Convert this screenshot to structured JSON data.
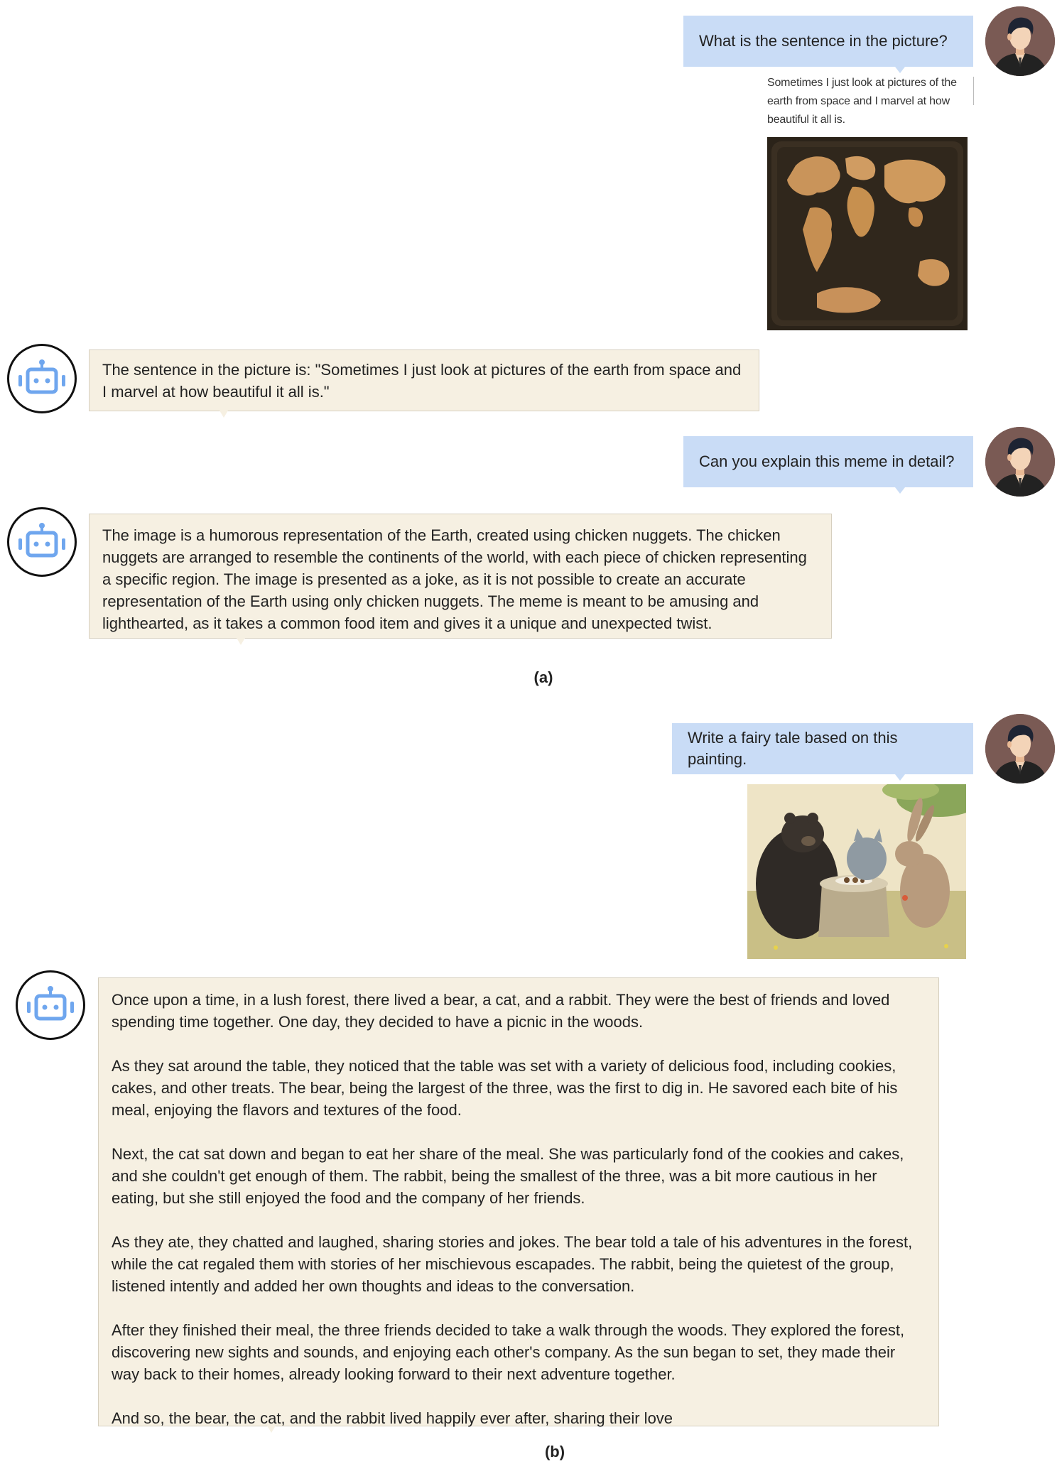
{
  "conversation_a": {
    "user_msg_1": "What is the sentence in the picture?",
    "meme_caption": "Sometimes I just look at pictures of the earth from space and I marvel at how beautiful it all is.",
    "bot_msg_1": "The sentence in the picture is: \"Sometimes I just look at pictures of the earth from space and I marvel at how beautiful it all is.\"",
    "user_msg_2": "Can you explain this meme in detail?",
    "bot_msg_2": "The image is a humorous representation of the Earth, created using chicken nuggets. The chicken nuggets are arranged to resemble the continents of the world, with each piece of chicken representing a specific region. The image is presented as a joke, as it is not possible to create an accurate representation of the Earth using only chicken nuggets. The meme is meant to be amusing and lighthearted, as it takes a common food item and gives it a unique and unexpected twist.",
    "label": "(a)"
  },
  "conversation_b": {
    "user_msg_1": "Write a fairy tale based on this painting.",
    "bot_paragraphs": [
      "Once upon a time, in a lush forest, there lived a bear, a cat, and a rabbit. They were the best of friends and loved spending time together. One day, they decided to have a picnic in the woods.",
      "As they sat around the table, they noticed that the table was set with a variety of delicious food, including cookies, cakes, and other treats. The bear, being the largest of the three, was the first to dig in. He savored each bite of his meal, enjoying the flavors and textures of the food.",
      "Next, the cat sat down and began to eat her share of the meal. She was particularly fond of the cookies and cakes, and she couldn't get enough of them. The rabbit, being the smallest of the three, was a bit more cautious in her eating, but she still enjoyed the food and the company of her friends.",
      "As they ate, they chatted and laughed, sharing stories and jokes. The bear told a tale of his adventures in the forest, while the cat regaled them with stories of her mischievous escapades. The rabbit, being the quietest of the group, listened intently and added her own thoughts and ideas to the conversation.",
      "After they finished their meal, the three friends decided to take a walk through the woods. They explored the forest, discovering new sights and sounds, and enjoying each other's company. As the sun began to set, they made their way back to their homes, already looking forward to their next adventure together.",
      "And so, the bear, the cat, and the rabbit lived happily ever after, sharing their love"
    ],
    "label": "(b)"
  },
  "colors": {
    "user_bubble": "#c9dcf6",
    "bot_bubble": "#f6f0e2",
    "bot_icon": "#6fa6ee",
    "user_avatar_bg": "#7a5a54"
  },
  "icons": {
    "user_avatar": "user-avatar-icon",
    "bot_avatar": "robot-icon"
  }
}
